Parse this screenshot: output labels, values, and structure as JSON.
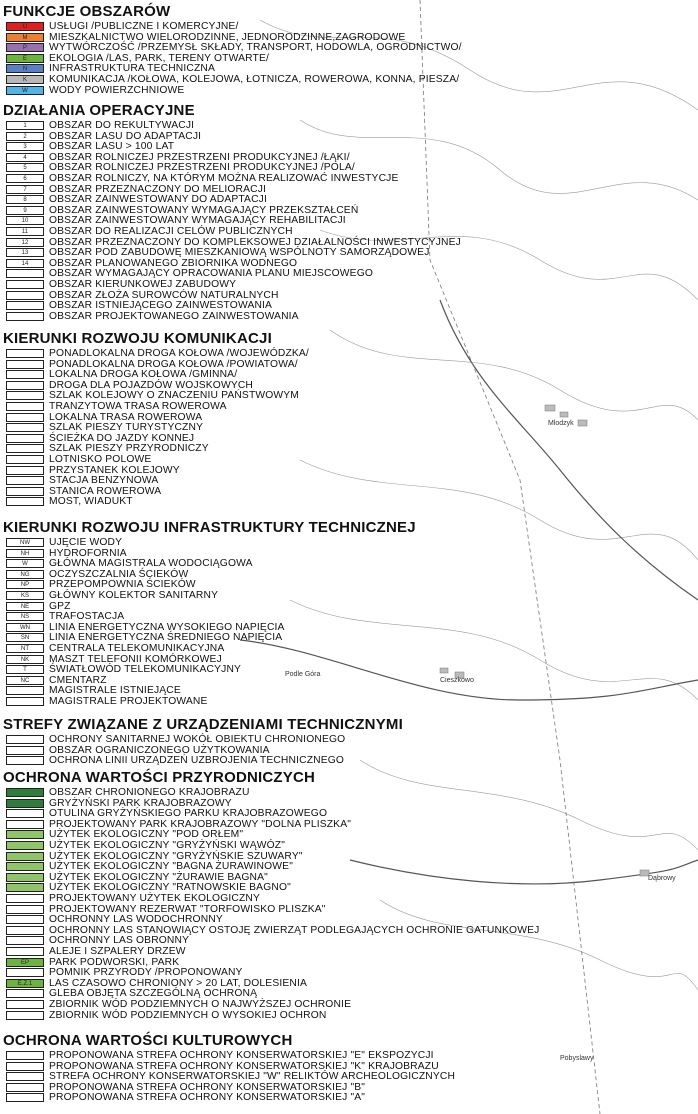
{
  "map": {
    "places": [
      "Mlodzyk",
      "Podle Góra",
      "Cieszkowo",
      "Dąbrowy",
      "Pobyslawy"
    ]
  },
  "sections": [
    {
      "title": "FUNKCJE OBSZARÓW",
      "items": [
        {
          "code": "U",
          "color": "#e0201e",
          "label": "USŁUGI /PUBLICZNE I KOMERCYJNE/"
        },
        {
          "code": "M",
          "color": "#ee7f2e",
          "label": "MIESZKALNICTWO WIELORODZINNE, JEDNORODZINNE,ZAGRODOWE"
        },
        {
          "code": "P",
          "color": "#9a6fb0",
          "label": "WYTWÓRCZOŚĆ /PRZEMYSŁ SKŁADY, TRANSPORT, HODOWLA, OGRODNICTWO/"
        },
        {
          "code": "E",
          "color": "#6db33f",
          "label": "EKOLOGIA /LAS, PARK, TERENY OTWARTE/"
        },
        {
          "code": "N",
          "color": "#5b7fc4",
          "label": "INFRASTRUKTURA TECHNICZNA"
        },
        {
          "code": "K",
          "color": "#b8b8b8",
          "label": "KOMUNIKACJA /KOŁOWA, KOLEJOWA, ŁOTNICZA, ROWEROWA, KONNA, PIESZA/"
        },
        {
          "code": "W",
          "color": "#52b4e6",
          "label": "WODY POWIERZCHNIOWE"
        }
      ]
    },
    {
      "title": "DZIAŁANIA OPERACYJNE",
      "items": [
        {
          "code": "1",
          "color": "#ffffff",
          "label": "OBSZAR DO REKULTYWACJI"
        },
        {
          "code": "2",
          "color": "#ffffff",
          "label": "OBSZAR LASU DO ADAPTACJI"
        },
        {
          "code": "3",
          "color": "#ffffff",
          "label": "OBSZAR LASU > 100 LAT"
        },
        {
          "code": "4",
          "color": "#ffffff",
          "label": "OBSZAR ROLNICZEJ PRZESTRZENI PRODUKCYJNEJ /ŁĄKI/"
        },
        {
          "code": "5",
          "color": "#ffffff",
          "label": "OBSZAR ROLNICZEJ PRZESTRZENI PRODUKCYJNEJ /POLA/"
        },
        {
          "code": "6",
          "color": "#ffffff",
          "label": "OBSZAR ROLNICZY, NA KTÓRYM MOŻNA REALIZOWAĆ INWESTYCJE"
        },
        {
          "code": "7",
          "color": "#ffffff",
          "label": "OBSZAR PRZEZNACZONY DO MELIORACJI"
        },
        {
          "code": "8",
          "color": "#ffffff",
          "label": "OBSZAR ZAINWESTOWANY DO ADAPTACJI"
        },
        {
          "code": "9",
          "color": "#ffffff",
          "label": "OBSZAR ZAINWESTOWANY WYMAGAJĄCY PRZEKSZTAŁCEŃ"
        },
        {
          "code": "10",
          "color": "#ffffff",
          "label": "OBSZAR ZAINWESTOWANY WYMAGAJĄCY REHABILITACJI"
        },
        {
          "code": "11",
          "color": "#ffffff",
          "label": "OBSZAR DO REALIZACJI CELÓW PUBLICZNYCH"
        },
        {
          "code": "12",
          "color": "#ffffff",
          "label": "OBSZAR PRZEZNACZONY DO KOMPLEKSOWEJ DZIAŁALNOŚCI INWESTYCYJNEJ"
        },
        {
          "code": "13",
          "color": "#ffffff",
          "label": "OBSZAR POD ZABUDOWĘ MIESZKANIOWĄ WSPÓLNOTY SAMORZĄDOWEJ"
        },
        {
          "code": "14",
          "color": "#ffffff",
          "label": "OBSZAR PLANOWANEGO ZBIORNIKA WODNEGO"
        },
        {
          "code": "",
          "color": "#ffffff",
          "label": "OBSZAR WYMAGAJĄCY OPRACOWANIA PLANU MIEJSCOWEGO"
        },
        {
          "code": "",
          "color": "#ffffff",
          "label": "OBSZAR KIERUNKOWEJ ZABUDOWY"
        },
        {
          "code": "",
          "color": "#ffffff",
          "label": "OBSZAR ZŁOŻA SUROWCÓW NATURALNYCH"
        },
        {
          "code": "",
          "color": "#ffffff",
          "label": "OBSZAR ISTNIEJĄCEGO ZAINWESTOWANIA"
        },
        {
          "code": "",
          "color": "#ffffff",
          "label": "OBSZAR PROJEKTOWANEGO ZAINWESTOWANIA"
        }
      ]
    },
    {
      "title": "KIERUNKI ROZWOJU KOMUNIKACJI",
      "items": [
        {
          "code": "",
          "color": "#ffffff",
          "label": "PONADLOKALNA DROGA KOŁOWA /WOJEWÓDZKA/"
        },
        {
          "code": "",
          "color": "#ffffff",
          "label": "PONADLOKALNA DROGA KOŁOWA /POWIATOWA/"
        },
        {
          "code": "",
          "color": "#ffffff",
          "label": "LOKALNA DROGA KOŁOWA /GMINNA/"
        },
        {
          "code": "",
          "color": "#ffffff",
          "label": "DROGA DLA POJAZDÓW WOJSKOWYCH"
        },
        {
          "code": "",
          "color": "#ffffff",
          "label": "SZLAK KOLEJOWY O ZNACZENIU PAŃSTWOWYM"
        },
        {
          "code": "",
          "color": "#ffffff",
          "label": "TRANZYTOWA TRASA ROWEROWA"
        },
        {
          "code": "",
          "color": "#ffffff",
          "label": "LOKALNA TRASA ROWEROWA"
        },
        {
          "code": "",
          "color": "#ffffff",
          "label": "SZLAK PIESZY TURYSTYCZNY"
        },
        {
          "code": "",
          "color": "#ffffff",
          "label": "ŚCIEŻKA DO JAZDY KONNEJ"
        },
        {
          "code": "",
          "color": "#ffffff",
          "label": "SZLAK PIESZY PRZYRODNICZY"
        },
        {
          "code": "",
          "color": "#ffffff",
          "label": "LOTNISKO POLOWE"
        },
        {
          "code": "",
          "color": "#ffffff",
          "label": "PRZYSTANEK KOLEJOWY"
        },
        {
          "code": "",
          "color": "#ffffff",
          "label": "STACJA BENZYNOWA"
        },
        {
          "code": "",
          "color": "#ffffff",
          "label": "STANICA ROWEROWA"
        },
        {
          "code": "",
          "color": "#ffffff",
          "label": "MOST, WIADUKT"
        }
      ]
    },
    {
      "title": "KIERUNKI ROZWOJU INFRASTRUKTURY TECHNICZNEJ",
      "items": [
        {
          "code": "NW",
          "color": "#ffffff",
          "label": "UJĘCIE WODY"
        },
        {
          "code": "NH",
          "color": "#ffffff",
          "label": "HYDROFORNIA"
        },
        {
          "code": "W",
          "color": "#ffffff",
          "label": "GŁÓWNA MAGISTRALA WODOCIĄGOWA"
        },
        {
          "code": "NG",
          "color": "#ffffff",
          "label": "OCZYSZCZALNIA ŚCIEKÓW"
        },
        {
          "code": "NP",
          "color": "#ffffff",
          "label": "PRZEPOMPOWNIA ŚCIEKÓW"
        },
        {
          "code": "KS",
          "color": "#ffffff",
          "label": "GŁÓWNY KOLEKTOR SANITARNY"
        },
        {
          "code": "NE",
          "color": "#ffffff",
          "label": "GPZ"
        },
        {
          "code": "NS",
          "color": "#ffffff",
          "label": "TRAFOSTACJA"
        },
        {
          "code": "WN",
          "color": "#ffffff",
          "label": "LINIA ENERGETYCZNA WYSOKIEGO NAPIĘCIA"
        },
        {
          "code": "SN",
          "color": "#ffffff",
          "label": "LINIA ENERGETYCZNA ŚREDNIEGO NAPIĘCIA"
        },
        {
          "code": "NT",
          "color": "#ffffff",
          "label": "CENTRALA TELEKOMUNIKACYJNA"
        },
        {
          "code": "NK",
          "color": "#ffffff",
          "label": "MASZT TELEFONII KOMÓRKOWEJ"
        },
        {
          "code": "T",
          "color": "#ffffff",
          "label": "ŚWIATŁOWÓD TELEKOMUNIKACYJNY"
        },
        {
          "code": "NC",
          "color": "#ffffff",
          "label": "CMENTARZ"
        },
        {
          "code": "",
          "color": "#ffffff",
          "label": "MAGISTRALE ISTNIEJĄCE"
        },
        {
          "code": "",
          "color": "#ffffff",
          "label": "MAGISTRALE PROJEKTOWANE"
        }
      ]
    },
    {
      "title": "STREFY ZWIĄZANE Z URZĄDZENIAMI TECHNICZNYMI",
      "items": [
        {
          "code": "",
          "color": "#ffffff",
          "label": "OCHRONY SANITARNEJ WOKÓŁ OBIEKTU CHRONIONEGO"
        },
        {
          "code": "",
          "color": "#ffffff",
          "label": "OBSZAR OGRANICZONEGO UŻYTKOWANIA"
        },
        {
          "code": "",
          "color": "#ffffff",
          "label": "OCHRONA LINII URZĄDZEŃ UZBROJENIA TECHNICZNEGO"
        }
      ]
    },
    {
      "title": "OCHRONA WARTOŚCI PRZYRODNICZYCH",
      "items": [
        {
          "code": "",
          "color": "#2f7d3a",
          "label": "OBSZAR CHRONIONEGO KRAJOBRAZU"
        },
        {
          "code": "",
          "color": "#2f7d3a",
          "label": "GRYŻYŃSKI PARK KRAJOBRAZOWY"
        },
        {
          "code": "",
          "color": "#ffffff",
          "label": "OTULINA GRYŻYŃSKIEGO PARKU KRAJOBRAZOWEGO"
        },
        {
          "code": "",
          "color": "#ffffff",
          "label": "PROJEKTOWANY PARK KRAJOBRAZOWY \"DOLNA PLISZKA\""
        },
        {
          "code": "",
          "color": "#8fc46a",
          "label": "UŻYTEK EKOLOGICZNY \"POD ORŁEM\""
        },
        {
          "code": "",
          "color": "#8fc46a",
          "label": "UŻYTEK EKOLOGICZNY \"GRYŻYŃSKI WĄWÓZ\""
        },
        {
          "code": "",
          "color": "#8fc46a",
          "label": "UŻYTEK EKOLOGICZNY \"GRYŻYŃSKIE SZUWARY\""
        },
        {
          "code": "",
          "color": "#8fc46a",
          "label": "UŻYTEK EKOLOGICZNY \"BAGNA ŻURAWINOWE\""
        },
        {
          "code": "",
          "color": "#8fc46a",
          "label": "UŻYTEK EKOLOGICZNY \"ŻURAWIE BAGNA\""
        },
        {
          "code": "",
          "color": "#8fc46a",
          "label": "UŻYTEK EKOLOGICZNY \"RATNOWSKIE BAGNO\""
        },
        {
          "code": "",
          "color": "#ffffff",
          "label": "PROJEKTOWANY UŻYTEK EKOLOGICZNY"
        },
        {
          "code": "",
          "color": "#ffffff",
          "label": "PROJEKTOWANY REZERWAT \"TORFOWISKO PLISZKA\""
        },
        {
          "code": "",
          "color": "#ffffff",
          "label": "OCHRONNY LAS WODOCHRONNY"
        },
        {
          "code": "",
          "color": "#ffffff",
          "label": "OCHRONNY LAS STANOWIĄCY OSTOJĘ ZWIERZĄT PODLEGAJĄCYCH OCHRONIE GATUNKOWEJ"
        },
        {
          "code": "",
          "color": "#ffffff",
          "label": "OCHRONNY LAS OBRONNY"
        },
        {
          "code": "",
          "color": "#ffffff",
          "label": "ALEJE I SZPALERY DRZEW"
        },
        {
          "code": "EP",
          "color": "#6db33f",
          "label": "PARK PODWORSKI, PARK"
        },
        {
          "code": "",
          "color": "#ffffff",
          "label": "POMNIK PRZYRODY /PROPONOWANY"
        },
        {
          "code": "E.Z.1",
          "color": "#6db33f",
          "label": "LAS CZASOWO CHRONIONY > 20 LAT, DOLESIENIA"
        },
        {
          "code": "",
          "color": "#ffffff",
          "label": "GLEBA OBJĘTA SZCZEGÓLNĄ OCHRONĄ"
        },
        {
          "code": "",
          "color": "#ffffff",
          "label": "ZBIORNIK WÓD PODZIEMNYCH O NAJWYŻSZEJ OCHRONIE"
        },
        {
          "code": "",
          "color": "#ffffff",
          "label": "ZBIORNIK WÓD PODZIEMNYCH O WYSOKIEJ OCHRON"
        }
      ]
    },
    {
      "title": "OCHRONA WARTOŚCI KULTUROWYCH",
      "items": [
        {
          "code": "",
          "color": "#ffffff",
          "label": "PROPONOWANA STREFA OCHRONY KONSERWATORSKIEJ \"E\" EKSPOZYCJI"
        },
        {
          "code": "",
          "color": "#ffffff",
          "label": "PROPONOWANA STREFA OCHRONY KONSERWATORSKIEJ \"K\" KRAJOBRAZU"
        },
        {
          "code": "",
          "color": "#ffffff",
          "label": "STREFA OCHRONY KONSERWATORSKIEJ \"W\" RELIKTÓW ARCHEOLOGICZNYCH"
        },
        {
          "code": "",
          "color": "#ffffff",
          "label": "PROPONOWANA STREFA OCHRONY KONSERWATORSKIEJ \"B\""
        },
        {
          "code": "",
          "color": "#ffffff",
          "label": "PROPONOWANA STREFA OCHRONY KONSERWATORSKIEJ \"A\""
        }
      ]
    }
  ]
}
